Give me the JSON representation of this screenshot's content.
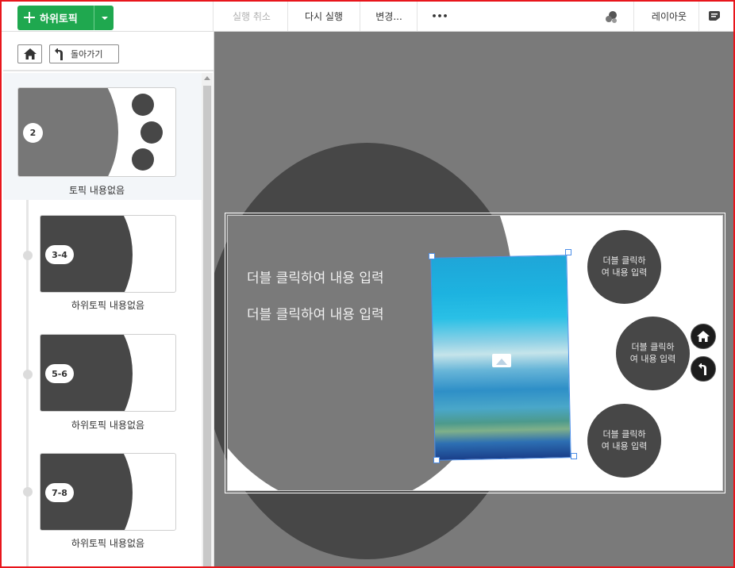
{
  "toolbar": {
    "add_subtopic_label": "하위토픽",
    "undo_label": "실행 취소",
    "redo_label": "다시 실행",
    "change_label": "변경...",
    "more_label": "•••",
    "layout_label": "레이아웃"
  },
  "sidebar": {
    "back_label": "돌아가기",
    "main_topic": {
      "badge": "2",
      "caption": "토픽 내용없음"
    },
    "subtopics": [
      {
        "badge": "3-4",
        "caption": "하위토픽 내용없음"
      },
      {
        "badge": "5-6",
        "caption": "하위토픽 내용없음"
      },
      {
        "badge": "7-8",
        "caption": "하위토픽 내용없음"
      }
    ]
  },
  "canvas": {
    "text_line_1": "더블 클릭하여 내용 입력",
    "text_line_2": "더블 클릭하여 내용 입력",
    "circle_1": "더블 클릭하\n여 내용 입력",
    "circle_2": "더블 클릭하\n여 내용 입력",
    "circle_3": "더블 클릭하\n여 내용 입력"
  },
  "colors": {
    "accent_green": "#1fa84f",
    "frame_red": "#e8161c",
    "canvas_gray": "#7a7a7a",
    "shape_dark": "#474747",
    "selection_blue": "#4d8fe8"
  },
  "icons": [
    "plus-icon",
    "caret-down-icon",
    "ellipsis-icon",
    "paint-icon",
    "layout-icon",
    "note-icon",
    "home-icon",
    "back-arrow-icon",
    "image-icon"
  ]
}
